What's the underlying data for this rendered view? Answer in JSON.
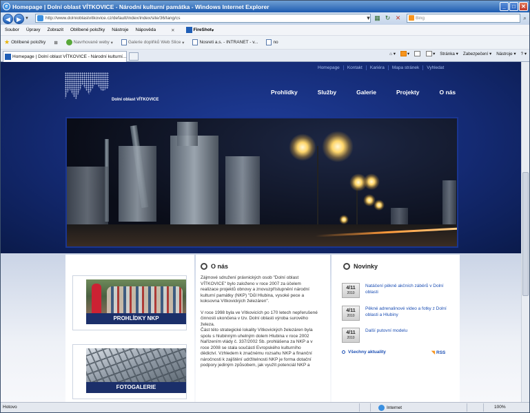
{
  "window": {
    "title": "Homepage | Dolní oblast VÍTKOVICE - Národní kulturní památka - Windows Internet Explorer",
    "minimize": "_",
    "maximize": "□",
    "close": "✕"
  },
  "address": {
    "url": "http://www.dolnioblastvitkovice.cz/default/index/index/site/36/lang/cs",
    "search_placeholder": "Bing"
  },
  "menu": {
    "items": [
      "Soubor",
      "Úpravy",
      "Zobrazit",
      "Oblíbené položky",
      "Nástroje",
      "Nápověda"
    ],
    "firefox_close": "✕",
    "fireshot": "FireShot"
  },
  "favorites": {
    "label": "Oblíbené položky",
    "items": [
      "Navrhované weby",
      "Galerie doplňků Web Slice",
      "Nosreti a.s. - INTRANET - v...",
      "no"
    ]
  },
  "tab": {
    "label": "Homepage | Dolní oblast VÍTKOVICE - Národní kulturní..."
  },
  "command_bar": {
    "items": [
      "Stránka",
      "Zabezpečení",
      "Nástroje"
    ]
  },
  "site": {
    "top_links": [
      "Homepage",
      "Kontakt",
      "Kariéra",
      "Mapa stránek",
      "Vyhledat"
    ],
    "logo_text": "Dolní oblast VÍTKOVICE",
    "nav": [
      "Prohlídky",
      "Služby",
      "Galerie",
      "Projekty",
      "O nás"
    ],
    "promos": [
      {
        "caption": "PROHLÍDKY NKP"
      },
      {
        "caption": "FOTOGALERIE"
      }
    ],
    "about": {
      "title": "O nás",
      "paragraphs": [
        "Zájmové sdružení právnických osob \"Dolní oblast VÍTKOVICE\" bylo založeno v roce 2007 za účelem realizace projektů obnovy a znovuzpřístupnění národní kulturní památky (NKP) \"Důl Hlubina, vysoké pece a koksovna Vítkovických železáren\".",
        "V roce 1998 byla ve Vítkovicích po 170 letech nepřerušené činnosti ukončena v tzv. Dolní oblasti výroba surového železa.",
        "Část této strategické lokality Vítkovických železáren byla spolu s hlubinným uhelným dolem Hlubina v roce 2002 Nařízením vlády č. 337/2002 Sb. prohlášena za NKP a v roce 2008 se stala součástí Evropského kulturního dědictví. Vzhledem k značnému rozsahu NKP a finanční náročnosti k zajištění udržitelnosti NKP je forma dotační podpory jediným způsobem, jak využít potenciál NKP a"
      ]
    },
    "news": {
      "title": "Novinky",
      "items": [
        {
          "date": "4/11",
          "year": "2010",
          "text": "Natáčení pěkně akčních záběrů v Dolní oblasti"
        },
        {
          "date": "4/11",
          "year": "2010",
          "text": "Pěkné adrenalinové video a fotky z Dolní oblasti a Hlubiny"
        },
        {
          "date": "4/11",
          "year": "2010",
          "text": "Další putovní modelu"
        }
      ],
      "all_link": "Všechny aktuality",
      "rss": "RSS"
    }
  },
  "status": {
    "text": "Hotovo",
    "zone": "Internet",
    "zoom": "100%"
  }
}
